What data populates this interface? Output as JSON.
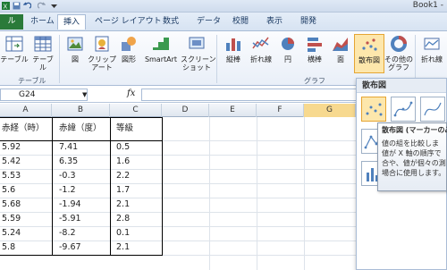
{
  "window": {
    "title": "Book1 -"
  },
  "tabs": [
    "ル",
    "ホーム",
    "挿入",
    "ページ レイアウト",
    "数式",
    "データ",
    "校閲",
    "表示",
    "開発"
  ],
  "ribbon": {
    "buttons": {
      "pivot_table": "テーブル",
      "table": "テーブル",
      "picture": "図",
      "clipart": "クリップ\nアート",
      "shapes": "図形",
      "smartart": "SmartArt",
      "screenshot": "スクリーン\nショット",
      "column": "縦棒",
      "line": "折れ線",
      "pie": "円",
      "bar": "横棒",
      "area": "面",
      "scatter": "散布図",
      "other": "その他の\nグラフ",
      "sparkline": "折れ線"
    },
    "groups": {
      "tables": "テーブル",
      "charts": "グラフ"
    }
  },
  "formula_bar": {
    "name_box": "G24",
    "fx": "fx",
    "value": ""
  },
  "columns": [
    "A",
    "B",
    "C",
    "D",
    "E",
    "F",
    "G"
  ],
  "table": {
    "headers": [
      "赤経（時）",
      "赤緯（度）",
      "等級"
    ],
    "rows": [
      [
        "5.92",
        "7.41",
        "0.5"
      ],
      [
        "5.42",
        "6.35",
        "1.6"
      ],
      [
        "5.53",
        "-0.3",
        "2.2"
      ],
      [
        "5.6",
        "-1.2",
        "1.7"
      ],
      [
        "5.68",
        "-1.94",
        "2.1"
      ],
      [
        "5.59",
        "-5.91",
        "2.8"
      ],
      [
        "5.24",
        "-8.2",
        "0.1"
      ],
      [
        "5.8",
        "-9.67",
        "2.1"
      ]
    ]
  },
  "dropdown": {
    "header": "散布図",
    "tooltip_title": "散布図 (マーカーのみ",
    "tooltip_lines": [
      "値の組を比較しま",
      "",
      "値が X 軸の順序で",
      "合や、値が個々の測",
      "場合に使用します。"
    ]
  },
  "colors": {
    "file_tab": "#2a7a3a",
    "selected_thumb": "#fde7ac",
    "ribbon_bg": "#e9eff8"
  }
}
